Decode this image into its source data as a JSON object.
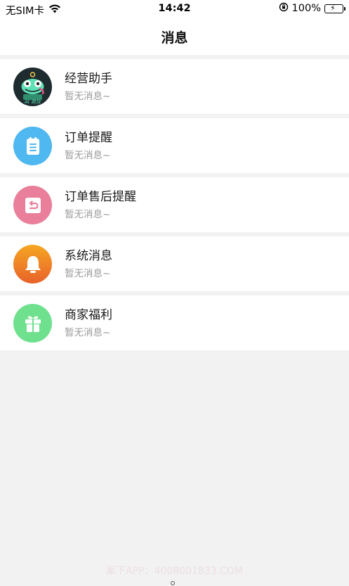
{
  "status_bar": {
    "carrier": "无SIM卡",
    "time": "14:42",
    "battery": "100%",
    "battery_level": 1.0
  },
  "header": {
    "title": "消息"
  },
  "items": [
    {
      "title": "经营助手",
      "subtitle": "暂无消息~",
      "icon": "assistant-mascot-icon",
      "color": "#1e2b2f",
      "avatar_text": "AI 商伙"
    },
    {
      "title": "订单提醒",
      "subtitle": "暂无消息~",
      "icon": "clipboard-icon",
      "color": "#4fb8f0"
    },
    {
      "title": "订单售后提醒",
      "subtitle": "暂无消息~",
      "icon": "return-box-icon",
      "color": "#e97f9b"
    },
    {
      "title": "系统消息",
      "subtitle": "暂无消息~",
      "icon": "bell-icon",
      "color": "#f0892e"
    },
    {
      "title": "商家福利",
      "subtitle": "暂无消息~",
      "icon": "gift-icon",
      "color": "#6ee08e"
    }
  ],
  "watermark": "案下APP：4008001833.COM",
  "colors": {
    "background": "#f2f2f2",
    "card": "#ffffff",
    "title_text": "#1a1a1a",
    "subtitle_text": "#9a9a9a"
  }
}
